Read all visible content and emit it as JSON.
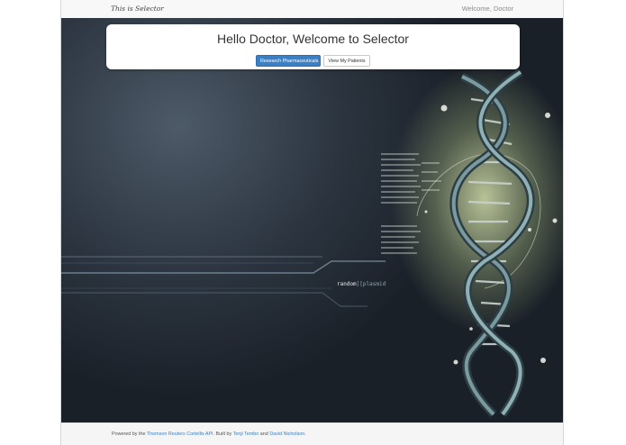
{
  "navbar": {
    "brand": "This is Selector",
    "welcome": "Welcome, Doctor"
  },
  "panel": {
    "title": "Hello Doctor, Welcome to Selector",
    "primary_button": "Research Pharmaceuticals",
    "secondary_button": "View My Patients"
  },
  "hero": {
    "code_label_left": "random",
    "code_label_sep": "][",
    "code_label_right": "plasmid"
  },
  "footer": {
    "prefix": "Powered by the ",
    "api_link": "Thomson Reuters Cortellis API",
    "middle": ". Built by ",
    "author1": "Tenji Tembo",
    "and": " and ",
    "author2": "David Nicholson",
    "suffix": "."
  },
  "colors": {
    "accent": "#3b7fc4",
    "hero_dark": "#2c3540",
    "helix_glow": "#d4deaa"
  }
}
